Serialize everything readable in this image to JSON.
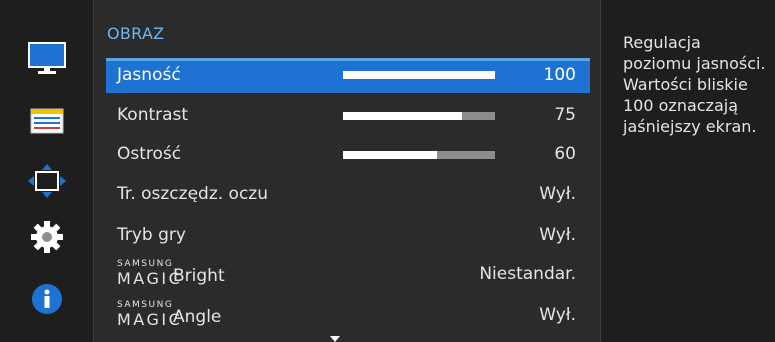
{
  "menu": {
    "title": "OBRAZ",
    "items": [
      {
        "label": "Jasność",
        "value": "100",
        "level": 1.0
      },
      {
        "label": "Kontrast",
        "value": "75",
        "level": 0.78
      },
      {
        "label": "Ostrość",
        "value": "60",
        "level": 0.62
      },
      {
        "label": "Tr. oszczędz. oczu",
        "value": "Wył."
      },
      {
        "label": "Tryb gry",
        "value": "Wył."
      },
      {
        "brand_top": "SAMSUNG",
        "brand_bottom": "MAGIC",
        "label": "Bright",
        "value": "Niestandar."
      },
      {
        "brand_top": "SAMSUNG",
        "brand_bottom": "MAGIC",
        "label": "Angle",
        "value": "Wył."
      }
    ]
  },
  "help": {
    "text": "Regulacja poziomu jasności. Wartości bliskie 100 oznaczają jaśniejszy ekran."
  },
  "icons": {
    "picture": "monitor-icon",
    "settings_list": "settings-list-icon",
    "size_position": "size-position-icon",
    "system": "gear-icon",
    "info": "info-icon"
  },
  "colors": {
    "accent": "#1e73d2",
    "title": "#6fb6f2",
    "panel": "#2b2b2b"
  }
}
